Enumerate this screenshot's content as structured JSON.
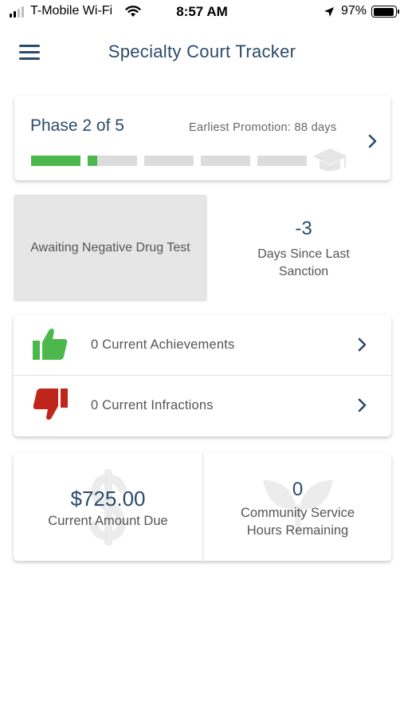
{
  "status_bar": {
    "carrier": "T-Mobile Wi-Fi",
    "time": "8:57 AM",
    "battery_percent": "97%",
    "battery_level": 0.97
  },
  "header": {
    "title": "Specialty Court Tracker",
    "menu_icon": "hamburger-icon"
  },
  "phase": {
    "title": "Phase 2 of 5",
    "earliest_promotion": "Earliest Promotion: 88 days",
    "segments_fill": [
      1,
      0.2,
      0,
      0,
      0
    ],
    "fill_color": "#4cb84c",
    "empty_color": "#dcdcdc",
    "icon": "graduation-cap-icon"
  },
  "drug_test": {
    "label": "Awaiting Negative Drug Test"
  },
  "sanction": {
    "value": "-3",
    "label": "Days Since Last Sanction"
  },
  "achievements": {
    "label": "0 Current Achievements",
    "icon": "thumbs-up-icon",
    "color": "#4cb84c"
  },
  "infractions": {
    "label": "0 Current Infractions",
    "icon": "thumbs-down-icon",
    "color": "#c0251c"
  },
  "amount_due": {
    "value": "$725.00",
    "label": "Current Amount Due",
    "icon": "dollar-sign-icon"
  },
  "community_service": {
    "value": "0",
    "label_line1": "Community Service",
    "label_line2": "Hours Remaining",
    "icon": "leaf-icon"
  },
  "colors": {
    "primary": "#2c4a6b",
    "text_muted": "#555555"
  }
}
